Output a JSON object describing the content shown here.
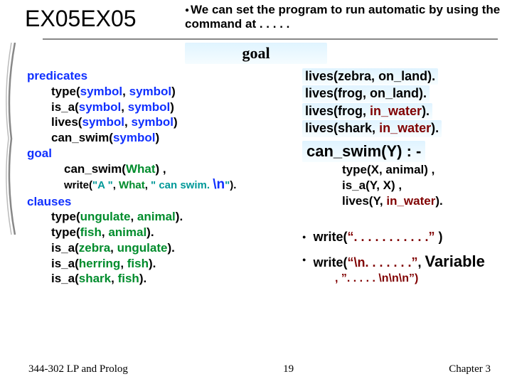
{
  "title": "EX05EX05",
  "topNote": "We can set the program to run automatic by using the command at . . . . .",
  "goalHeader": "goal",
  "leftCode": {
    "l1": "predicates",
    "l2a": "type(",
    "l2b": "symbol",
    "l2c": ", ",
    "l2d": "symbol",
    "l2e": ")",
    "l3a": "is_a(",
    "l3b": "symbol",
    "l3c": ", ",
    "l3d": "symbol",
    "l3e": ")",
    "l4a": "lives(",
    "l4b": "symbol",
    "l4c": ", ",
    "l4d": "symbol",
    "l4e": ")",
    "l5a": "can_swim(",
    "l5b": "symbol",
    "l5c": ")",
    "l6": "goal",
    "l7a": "can_swim(",
    "l7b": "What",
    "l7c": ") ,",
    "writeA": "write(",
    "writeB": "\"A \"",
    "writeC": ", ",
    "writeD": "What",
    "writeE": ", ",
    "writeF": "\" can swim. ",
    "writeG": "\\n",
    "writeH": "\"",
    "writeI": ").",
    "l9": "clauses",
    "l10a": "type(",
    "l10b": "ungulate",
    "l10c": ", ",
    "l10d": "animal",
    "l10e": ").",
    "l11a": "type(",
    "l11b": "fish",
    "l11c": ", ",
    "l11d": "animal",
    "l11e": ").",
    "l12a": " is_a(",
    "l12b": "zebra",
    "l12c": ", ",
    "l12d": "ungulate",
    "l12e": ").",
    "l13a": "is_a(",
    "l13b": "herring",
    "l13c": ", ",
    "l13d": "fish",
    "l13e": ").",
    "l14a": "is_a(",
    "l14b": "shark",
    "l14c": ", ",
    "l14d": "fish",
    "l14e": ")."
  },
  "rightCol": {
    "r1a": "lives(zebra, ",
    "r1b": "on_land",
    "r1c": ").",
    "r2a": "lives(frog, ",
    "r2b": "on_land",
    "r2c": ").",
    "r3a": "lives(frog, ",
    "r3b": "in_water",
    "r3c": ").",
    "r4a": "lives(shark, ",
    "r4b": "in_water",
    "r4c": ").",
    "can": "can_swim(Y) : -",
    "s1": "type(X, animal) ,",
    "s2": "is_a(Y, X) ,",
    "s3a": "lives(Y, ",
    "s3b": "in_water",
    "s3c": ").",
    "b1a": "write(",
    "b1b": "“. . . . . . . . . . .”",
    "b1c": " )",
    "b2a": "write(",
    "b2b": "“\\n. . . . . . .”",
    "b2c": ", ",
    "b2d": "Variable",
    "b2cont": ", ”. . . . . \\n\\n\\n”)"
  },
  "footer": {
    "left": "344-302 LP and Prolog",
    "center": "19",
    "right": "Chapter 3"
  }
}
